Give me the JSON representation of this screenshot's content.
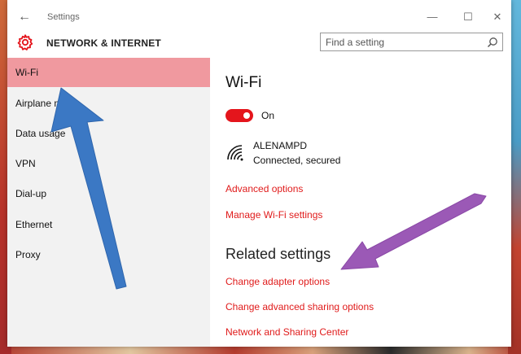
{
  "window": {
    "app_title": "Settings",
    "back_glyph": "←",
    "controls": {
      "minimize": "—",
      "maximize": "☐",
      "close": "✕"
    }
  },
  "header": {
    "icon": "gear-icon",
    "title": "NETWORK & INTERNET",
    "search": {
      "placeholder": "Find a setting",
      "value": "",
      "icon": "search-icon"
    }
  },
  "sidebar": {
    "items": [
      {
        "label": "Wi-Fi",
        "active": true
      },
      {
        "label": "Airplane mode",
        "active": false
      },
      {
        "label": "Data usage",
        "active": false
      },
      {
        "label": "VPN",
        "active": false
      },
      {
        "label": "Dial-up",
        "active": false
      },
      {
        "label": "Ethernet",
        "active": false
      },
      {
        "label": "Proxy",
        "active": false
      }
    ]
  },
  "main": {
    "title": "Wi-Fi",
    "toggle": {
      "state": "On",
      "on": true
    },
    "network": {
      "name": "ALENAMPD",
      "status": "Connected, secured",
      "icon": "wifi-signal-icon"
    },
    "links": [
      "Advanced options",
      "Manage Wi-Fi settings"
    ],
    "related": {
      "title": "Related settings",
      "links": [
        "Change adapter options",
        "Change advanced sharing options",
        "Network and Sharing Center"
      ]
    }
  },
  "annotations": {
    "blue_arrow_color": "#3b78c4",
    "purple_arrow_color": "#9b59b6"
  },
  "colors": {
    "accent": "#e4151c",
    "active_nav": "#f0999f",
    "link": "#e01b1b"
  }
}
